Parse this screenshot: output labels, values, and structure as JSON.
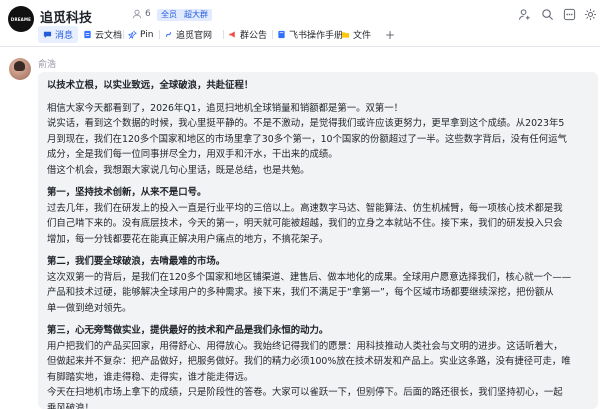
{
  "header": {
    "logo_text": "DREAME",
    "title": "追觅科技",
    "member_count": "6",
    "badge_all": "全员",
    "badge_group": "超大群"
  },
  "tabs": [
    {
      "label": "消息"
    },
    {
      "label": "云文档"
    },
    {
      "label": "Pin"
    },
    {
      "label": "追觅官网"
    },
    {
      "label": "群公告"
    },
    {
      "label": "飞书操作手册"
    },
    {
      "label": "文件"
    },
    {
      "label": "+"
    }
  ],
  "message": {
    "sender": "俞浩",
    "lines": [
      "以技术立根，以实业致远，全球破浪，共赴征程！",
      "相信大家今天都看到了，2026年Q1，追觅扫地机全球销量和销额都是第一。双第一！",
      "说实话，看到这个数据的时候，我心里挺平静的。不是不激动，是觉得我们或许应该更努力，更早拿到这个成绩。从2023年5",
      "月到现在，我们在120多个国家和地区的市场里拿了30多个第一，10个国家的份额超过了一半。这些数字背后，没有任何运气",
      "成分，全是我们每一位同事拼尽全力，用双手和汗水，干出来的成绩。",
      "借这个机会，我想跟大家说几句心里话，既是总结，也是共勉。",
      "第一，坚持技术创新，从来不是口号。",
      "过去几年，我们在研发上的投入一直是行业平均的三倍以上。高速数字马达、智能算法、仿生机械臂，每一项核心技术都是我",
      "们自己啃下来的。没有底层技术，今天的第一，明天就可能被超越，我们的立身之本就站不住。接下来，我们的研发投入只会",
      "增加，每一分钱都要花在能真正解决用户痛点的地方，不搞花架子。",
      "第二，我们要全球破浪，去啃最难的市场。",
      "这次双第一的背后，是我们在120多个国家和地区铺渠道、建售后、做本地化的成果。全球用户愿意选择我们，核心就一个——",
      "产品和技术过硬，能够解决全球用户的多种需求。接下来，我们不满足于“拿第一”，每个区域市场都要继续深挖，把份额从",
      "单一做到绝对领先。",
      "第三，心无旁骛做实业，提供最好的技术和产品是我们永恒的动力。",
      "用户把我们的产品买回家，用得舒心、用得放心。我始终记得我们的愿景：用科技推动人类社会与文明的进步。这话听着大，",
      "但做起来并不复杂：把产品做好，把服务做好。我们的精力必须100%放在技术研发和产品上。实业这条路，没有捷径可走，唯",
      "有脚踏实地，谁走得稳、走得实，谁才能走得远。",
      "今天在扫地机市场上拿下的成绩，只是阶段性的答卷。大家可以雀跃一下，但别停下。后面的路还很长，我们坚持初心，一起",
      "乘风破浪！"
    ]
  },
  "colors": {
    "accent": "#245bdb",
    "bubble": "#f2f3f5",
    "text": "#1f2329",
    "muted": "#8f959e"
  }
}
